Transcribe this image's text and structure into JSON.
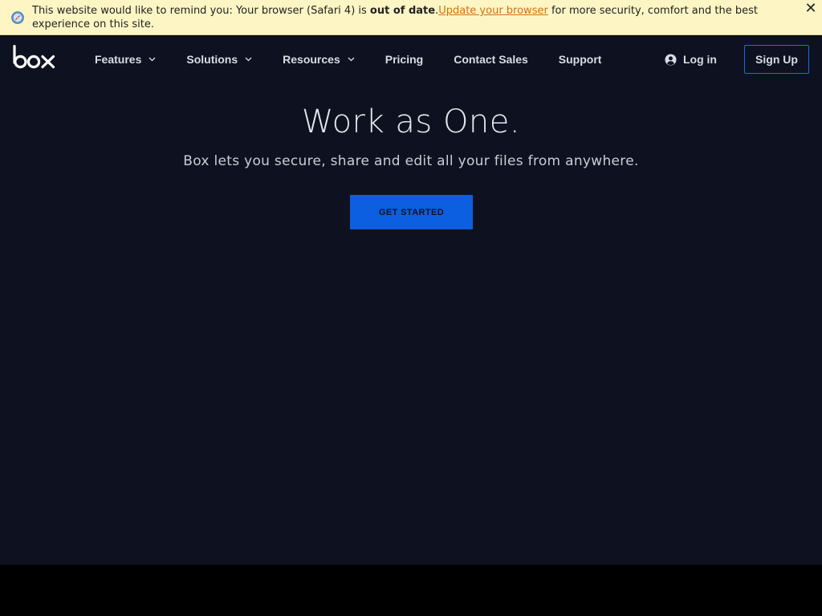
{
  "banner": {
    "text_before": "This website would like to remind you: Your browser (Safari 4) is ",
    "text_bold": "out of date",
    "text_period": ".",
    "link_text": "Update your browser",
    "text_after": " for more security, comfort and the best experience on this site.",
    "close_label": "✕",
    "icon": "safari-compass-icon",
    "background_color": "#fdf6c4",
    "link_color": "#d0720a"
  },
  "header": {
    "logo": "box",
    "nav": [
      {
        "label": "Features",
        "has_dropdown": true
      },
      {
        "label": "Solutions",
        "has_dropdown": true
      },
      {
        "label": "Resources",
        "has_dropdown": true
      },
      {
        "label": "Pricing",
        "has_dropdown": false
      },
      {
        "label": "Contact Sales",
        "has_dropdown": false
      },
      {
        "label": "Support",
        "has_dropdown": false
      }
    ],
    "login_label": "Log in",
    "login_icon": "user-circle-icon",
    "signup_label": "Sign Up",
    "signup_border_color": "#2b63d9"
  },
  "hero": {
    "title": "Work as One.",
    "subtitle": "Box lets you secure, share and edit all your files from anywhere.",
    "cta_label": "GET STARTED",
    "cta_color": "#0b5fe0",
    "background_color": "#0e1220"
  }
}
